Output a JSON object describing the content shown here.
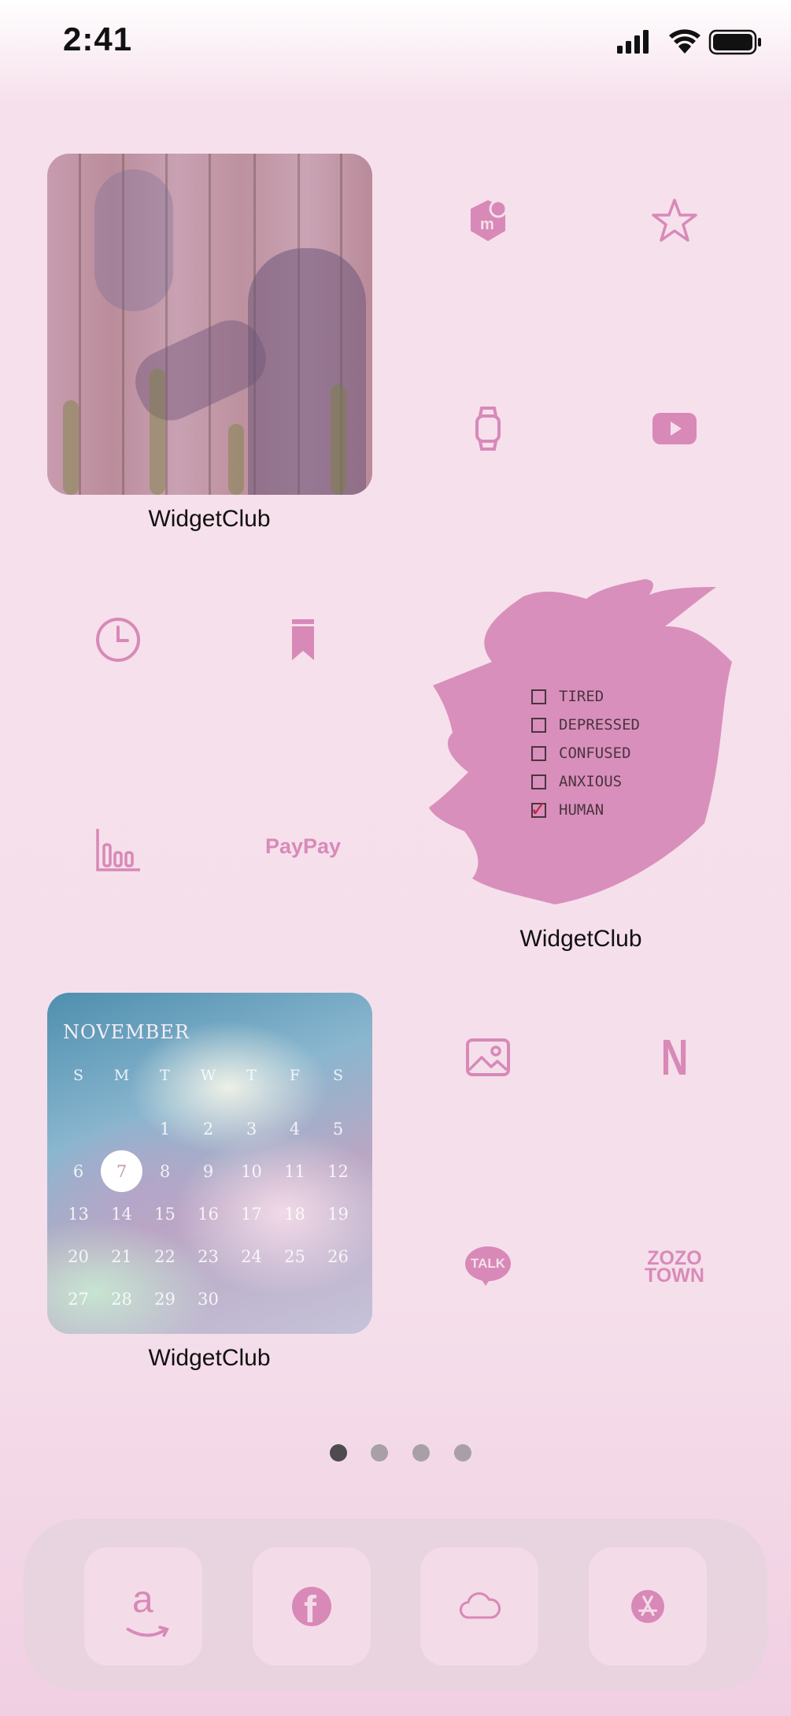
{
  "status_bar": {
    "time": "2:41",
    "icons": [
      "cellular-signal-icon",
      "wifi-icon",
      "battery-icon"
    ]
  },
  "home_screen": {
    "widgets": [
      {
        "id": "photo-widget",
        "label": "WidgetClub"
      },
      {
        "id": "checklist-widget",
        "label": "WidgetClub",
        "items": [
          {
            "text": "TIRED",
            "checked": false
          },
          {
            "text": "DEPRESSED",
            "checked": false
          },
          {
            "text": "CONFUSED",
            "checked": false
          },
          {
            "text": "ANXIOUS",
            "checked": false
          },
          {
            "text": "HUMAN",
            "checked": true
          }
        ]
      },
      {
        "id": "calendar-widget",
        "label": "WidgetClub",
        "month": "NOVEMBER",
        "weekdays": [
          "S",
          "M",
          "T",
          "W",
          "T",
          "F",
          "S"
        ],
        "weeks": [
          [
            "",
            "",
            "1",
            "2",
            "3",
            "4",
            "5"
          ],
          [
            "6",
            "7",
            "8",
            "9",
            "10",
            "11",
            "12"
          ],
          [
            "13",
            "14",
            "15",
            "16",
            "17",
            "18",
            "19"
          ],
          [
            "20",
            "21",
            "22",
            "23",
            "24",
            "25",
            "26"
          ],
          [
            "27",
            "28",
            "29",
            "30",
            "",
            "",
            ""
          ]
        ],
        "today": "7"
      }
    ],
    "apps": [
      {
        "icon": "mercari-icon"
      },
      {
        "icon": "star-icon"
      },
      {
        "icon": "watch-icon"
      },
      {
        "icon": "youtube-icon"
      },
      {
        "icon": "clock-icon"
      },
      {
        "icon": "bookmark-icon"
      },
      {
        "icon": "bar-chart-icon"
      },
      {
        "icon": "paypay-icon",
        "text": "PayPay"
      },
      {
        "icon": "photos-icon"
      },
      {
        "icon": "netflix-icon",
        "text": "N"
      },
      {
        "icon": "line-talk-icon",
        "text": "TALK"
      },
      {
        "icon": "zozotown-icon",
        "text_line1": "ZOZO",
        "text_line2": "TOWN"
      }
    ],
    "page_indicator": {
      "total": 4,
      "current": 1
    }
  },
  "dock": {
    "apps": [
      {
        "icon": "amazon-icon",
        "text": "a"
      },
      {
        "icon": "facebook-icon",
        "text": "f"
      },
      {
        "icon": "icloud-icon"
      },
      {
        "icon": "app-store-icon"
      }
    ]
  },
  "colors": {
    "accent_pink": "#d889b7",
    "brush_pink": "#d98fbb",
    "background": "#f5dfeb"
  }
}
